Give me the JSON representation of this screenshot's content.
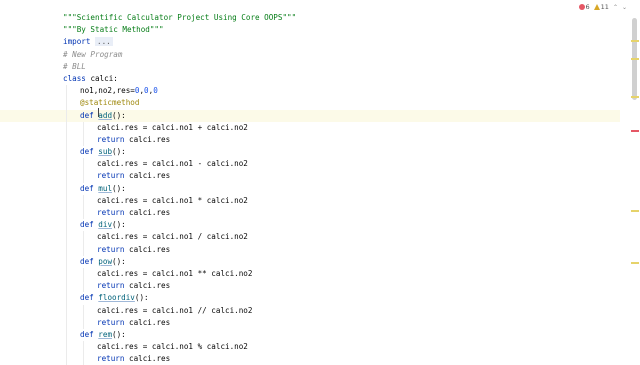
{
  "code": {
    "lines": [
      {
        "indent": 0,
        "segments": [
          {
            "cls": "str",
            "text": "\"\"\"Scientific Calculator Project Using Core OOPS\"\"\""
          }
        ]
      },
      {
        "indent": 0,
        "segments": [
          {
            "cls": "str",
            "text": "\"\"\"By Static Method\"\"\""
          }
        ]
      },
      {
        "indent": 0,
        "segments": [
          {
            "cls": "kw",
            "text": "import "
          },
          {
            "cls": "fold",
            "text": "..."
          }
        ]
      },
      {
        "indent": 0,
        "segments": [
          {
            "cls": "cm",
            "text": "# New Program"
          }
        ]
      },
      {
        "indent": 0,
        "segments": [
          {
            "cls": "cm",
            "text": "# BLL"
          }
        ]
      },
      {
        "indent": 0,
        "segments": [
          {
            "cls": "kw",
            "text": "class "
          },
          {
            "cls": "",
            "text": "calci:"
          }
        ]
      },
      {
        "indent": 1,
        "segments": [
          {
            "cls": "",
            "text": "no1,no2,res="
          },
          {
            "cls": "num",
            "text": "0"
          },
          {
            "cls": "",
            "text": ","
          },
          {
            "cls": "num",
            "text": "0"
          },
          {
            "cls": "",
            "text": ","
          },
          {
            "cls": "num",
            "text": "0"
          }
        ]
      },
      {
        "indent": 1,
        "segments": [
          {
            "cls": "dec",
            "text": "@staticmethod"
          }
        ]
      },
      {
        "indent": 1,
        "hl": true,
        "segments": [
          {
            "cls": "kw",
            "text": "def "
          },
          {
            "cls": "fnu",
            "text": "add"
          },
          {
            "cls": "",
            "text": "():"
          }
        ]
      },
      {
        "indent": 2,
        "segments": [
          {
            "cls": "",
            "text": "calci.res = calci.no1 + calci.no2"
          }
        ]
      },
      {
        "indent": 2,
        "segments": [
          {
            "cls": "kw",
            "text": "return "
          },
          {
            "cls": "",
            "text": "calci.res"
          }
        ]
      },
      {
        "indent": 1,
        "segments": [
          {
            "cls": "kw",
            "text": "def "
          },
          {
            "cls": "fnu",
            "text": "sub"
          },
          {
            "cls": "",
            "text": "():"
          }
        ]
      },
      {
        "indent": 2,
        "segments": [
          {
            "cls": "",
            "text": "calci.res = calci.no1 - calci.no2"
          }
        ]
      },
      {
        "indent": 2,
        "segments": [
          {
            "cls": "kw",
            "text": "return "
          },
          {
            "cls": "",
            "text": "calci.res"
          }
        ]
      },
      {
        "indent": 1,
        "segments": [
          {
            "cls": "kw",
            "text": "def "
          },
          {
            "cls": "fnu",
            "text": "mul"
          },
          {
            "cls": "",
            "text": "():"
          }
        ]
      },
      {
        "indent": 2,
        "segments": [
          {
            "cls": "",
            "text": "calci.res = calci.no1 * calci.no2"
          }
        ]
      },
      {
        "indent": 2,
        "segments": [
          {
            "cls": "kw",
            "text": "return "
          },
          {
            "cls": "",
            "text": "calci.res"
          }
        ]
      },
      {
        "indent": 1,
        "segments": [
          {
            "cls": "kw",
            "text": "def "
          },
          {
            "cls": "fnu",
            "text": "div"
          },
          {
            "cls": "",
            "text": "():"
          }
        ]
      },
      {
        "indent": 2,
        "segments": [
          {
            "cls": "",
            "text": "calci.res = calci.no1 / calci.no2"
          }
        ]
      },
      {
        "indent": 2,
        "segments": [
          {
            "cls": "kw",
            "text": "return "
          },
          {
            "cls": "",
            "text": "calci.res"
          }
        ]
      },
      {
        "indent": 1,
        "segments": [
          {
            "cls": "kw",
            "text": "def "
          },
          {
            "cls": "fnu",
            "text": "pow"
          },
          {
            "cls": "",
            "text": "():"
          }
        ]
      },
      {
        "indent": 2,
        "segments": [
          {
            "cls": "",
            "text": "calci.res = calci.no1 ** calci.no2"
          }
        ]
      },
      {
        "indent": 2,
        "segments": [
          {
            "cls": "kw",
            "text": "return "
          },
          {
            "cls": "",
            "text": "calci.res"
          }
        ]
      },
      {
        "indent": 1,
        "segments": [
          {
            "cls": "kw",
            "text": "def "
          },
          {
            "cls": "fnu",
            "text": "floordiv"
          },
          {
            "cls": "",
            "text": "():"
          }
        ]
      },
      {
        "indent": 2,
        "segments": [
          {
            "cls": "",
            "text": "calci.res = calci.no1 // calci.no2"
          }
        ]
      },
      {
        "indent": 2,
        "segments": [
          {
            "cls": "kw",
            "text": "return "
          },
          {
            "cls": "",
            "text": "calci.res"
          }
        ]
      },
      {
        "indent": 1,
        "segments": [
          {
            "cls": "kw",
            "text": "def "
          },
          {
            "cls": "fnu",
            "text": "rem"
          },
          {
            "cls": "",
            "text": "():"
          }
        ]
      },
      {
        "indent": 2,
        "segments": [
          {
            "cls": "",
            "text": "calci.res = calci.no1 % calci.no2"
          }
        ]
      },
      {
        "indent": 2,
        "segments": [
          {
            "cls": "kw",
            "text": "return "
          },
          {
            "cls": "",
            "text": "calci.res"
          }
        ]
      }
    ]
  },
  "inspections": {
    "errors": "6",
    "warnings": "11",
    "error_icon": "error-dot-icon",
    "warning_icon": "warning-triangle-icon",
    "expand_icon": "chevron-up-icon",
    "collapse_icon": "chevron-down-icon"
  },
  "colors": {
    "string": "#067d17",
    "keyword": "#0033b3",
    "comment": "#8c8c8c",
    "number": "#1750eb",
    "decorator": "#9e880d",
    "function": "#00627a"
  }
}
